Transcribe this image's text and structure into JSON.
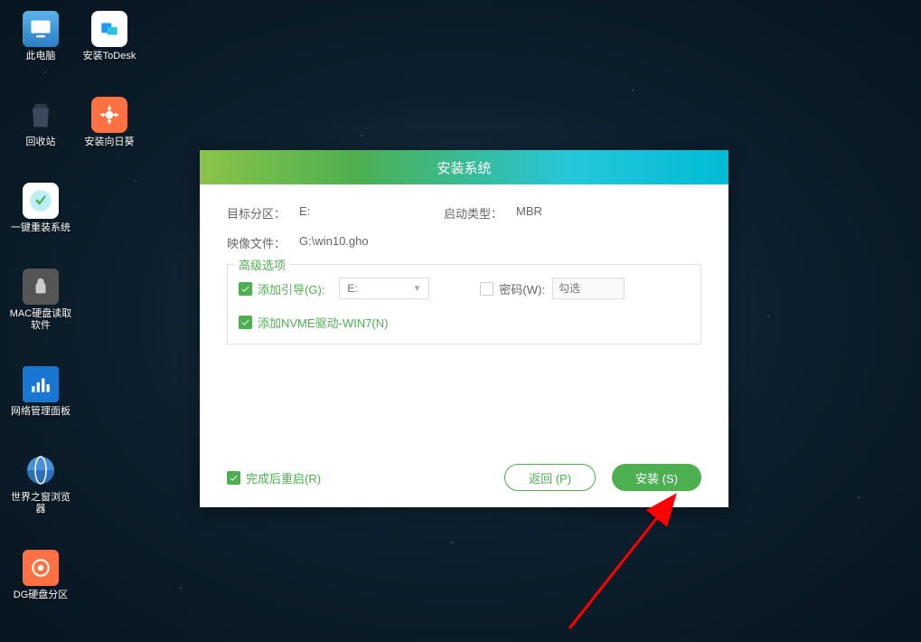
{
  "desktop_icons": {
    "this_pc": "此电脑",
    "todesk": "安装ToDesk",
    "recycle_bin": "回收站",
    "sunflower": "安装向日葵",
    "reinstall": "一键重装系统",
    "mac_disk": "MAC硬盘读取软件",
    "network_panel": "网络管理面板",
    "browser": "世界之窗浏览器",
    "dg_partition": "DG硬盘分区"
  },
  "dialog": {
    "title": "安装系统",
    "target_partition_label": "目标分区：",
    "target_partition_value": "E:",
    "boot_type_label": "启动类型：",
    "boot_type_value": "MBR",
    "image_file_label": "映像文件：",
    "image_file_value": "G:\\win10.gho",
    "advanced_title": "高级选项",
    "add_boot_label": "添加引导(G):",
    "add_boot_value": "E:",
    "password_label": "密码(W):",
    "password_placeholder": "勾选",
    "nvme_label": "添加NVME驱动-WIN7(N)",
    "restart_label": "完成后重启(R)",
    "back_button": "返回 (P)",
    "install_button": "安装 (S)"
  }
}
